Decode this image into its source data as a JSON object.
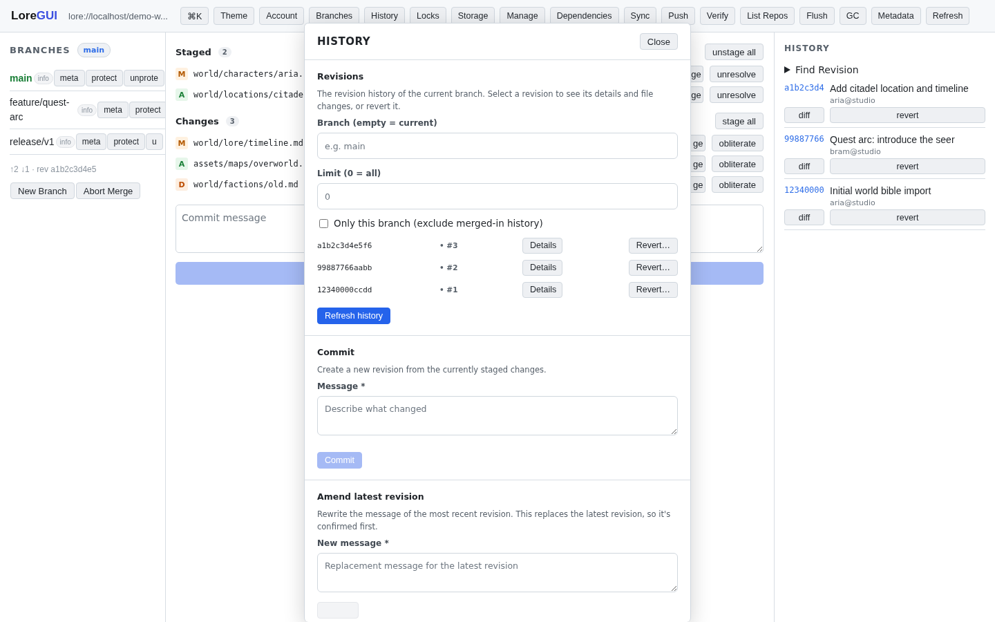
{
  "topbar": {
    "logo": {
      "text": "Lore",
      "accent": "GUI"
    },
    "address": "lore://localhost/demo-w...",
    "buttons": [
      "⌘K",
      "Theme",
      "Account",
      "Branches",
      "History",
      "Locks",
      "Storage",
      "Manage",
      "Dependencies",
      "Sync",
      "Push",
      "Verify",
      "List Repos",
      "Flush",
      "GC",
      "Metadata",
      "Refresh"
    ]
  },
  "branches": {
    "title": "BRANCHES",
    "current": "main",
    "items": [
      {
        "name": "main",
        "current": true,
        "tag": "info",
        "actions": [
          "meta",
          "protect",
          "unprote"
        ]
      },
      {
        "name": "feature/quest-arc",
        "current": false,
        "tag": "info",
        "actions": [
          "meta",
          "protect"
        ]
      },
      {
        "name": "release/v1",
        "current": false,
        "tag": "info",
        "actions": [
          "meta",
          "protect",
          "u"
        ]
      }
    ],
    "status": "↑2 ↓1 · rev a1b2c3d4e5",
    "buttons": [
      "New Branch",
      "Abort Merge"
    ]
  },
  "workspace": {
    "groups": [
      {
        "title": "Staged",
        "count": "2",
        "action": "unstage all",
        "files": [
          {
            "status": "M",
            "kind": "modified",
            "path": "world/characters/aria.",
            "actions": [
              "ge",
              "unresolve"
            ]
          },
          {
            "status": "A",
            "kind": "added",
            "path": "world/locations/citade",
            "actions": [
              "ge",
              "unresolve"
            ]
          }
        ]
      },
      {
        "title": "Changes",
        "count": "3",
        "action": "stage all",
        "files": [
          {
            "status": "M",
            "kind": "modified",
            "path": "world/lore/timeline.md",
            "actions": [
              "ge",
              "obliterate"
            ]
          },
          {
            "status": "A",
            "kind": "added",
            "path": "assets/maps/overworld.",
            "actions": [
              "ge",
              "obliterate"
            ]
          },
          {
            "status": "D",
            "kind": "deleted",
            "path": "world/factions/old.md",
            "actions": [
              "ge",
              "obliterate"
            ]
          }
        ]
      }
    ],
    "commit_message": {
      "placeholder": "Commit message"
    }
  },
  "history_modal": {
    "title": "HISTORY",
    "close": "Close",
    "sections": [
      {
        "kind": "revisions",
        "title": "Revisions",
        "description": "The revision history of the current branch. Select a revision to see its details and file changes, or revert it.",
        "fields": [
          {
            "label": "Branch (empty = current)",
            "placeholder": "e.g. main"
          },
          {
            "label": "Limit (0 = all)",
            "placeholder": "0"
          }
        ],
        "checkbox": {
          "label": "Only this branch (exclude merged-in history)",
          "checked": false
        },
        "revisions": [
          {
            "hash": "a1b2c3d4e5f6",
            "number": "• #3",
            "details": "Details",
            "revert": "Revert…"
          },
          {
            "hash": "99887766aabb",
            "number": "• #2",
            "details": "Details",
            "revert": "Revert…"
          },
          {
            "hash": "12340000ccdd",
            "number": "• #1",
            "details": "Details",
            "revert": "Revert…"
          }
        ],
        "button": {
          "label": "Refresh history",
          "disabled": false
        }
      },
      {
        "kind": "form",
        "title": "Commit",
        "description": "Create a new revision from the currently staged changes.",
        "fields": [
          {
            "label": "Message *",
            "placeholder": "Describe what changed"
          }
        ],
        "button": {
          "label": "Commit",
          "disabled": true
        }
      },
      {
        "kind": "form",
        "title": "Amend latest revision",
        "description": "Rewrite the message of the most recent revision. This replaces the latest revision, so it's confirmed first.",
        "fields": [
          {
            "label": "New message *",
            "placeholder": "Replacement message for the latest revision"
          }
        ],
        "button": {
          "disabled": true
        }
      }
    ]
  },
  "history_panel": {
    "title": "HISTORY",
    "find": {
      "label": "Find Revision",
      "expanded": false
    },
    "revisions": [
      {
        "hash": "a1b2c3d4",
        "message": "Add citadel location and timeline",
        "author": "aria@studio",
        "actions": [
          "diff",
          "revert"
        ]
      },
      {
        "hash": "99887766",
        "message": "Quest arc: introduce the seer",
        "author": "bram@studio",
        "actions": [
          "diff",
          "revert"
        ]
      },
      {
        "hash": "12340000",
        "message": "Initial world bible import",
        "author": "aria@studio",
        "actions": [
          "diff",
          "revert"
        ]
      }
    ]
  }
}
